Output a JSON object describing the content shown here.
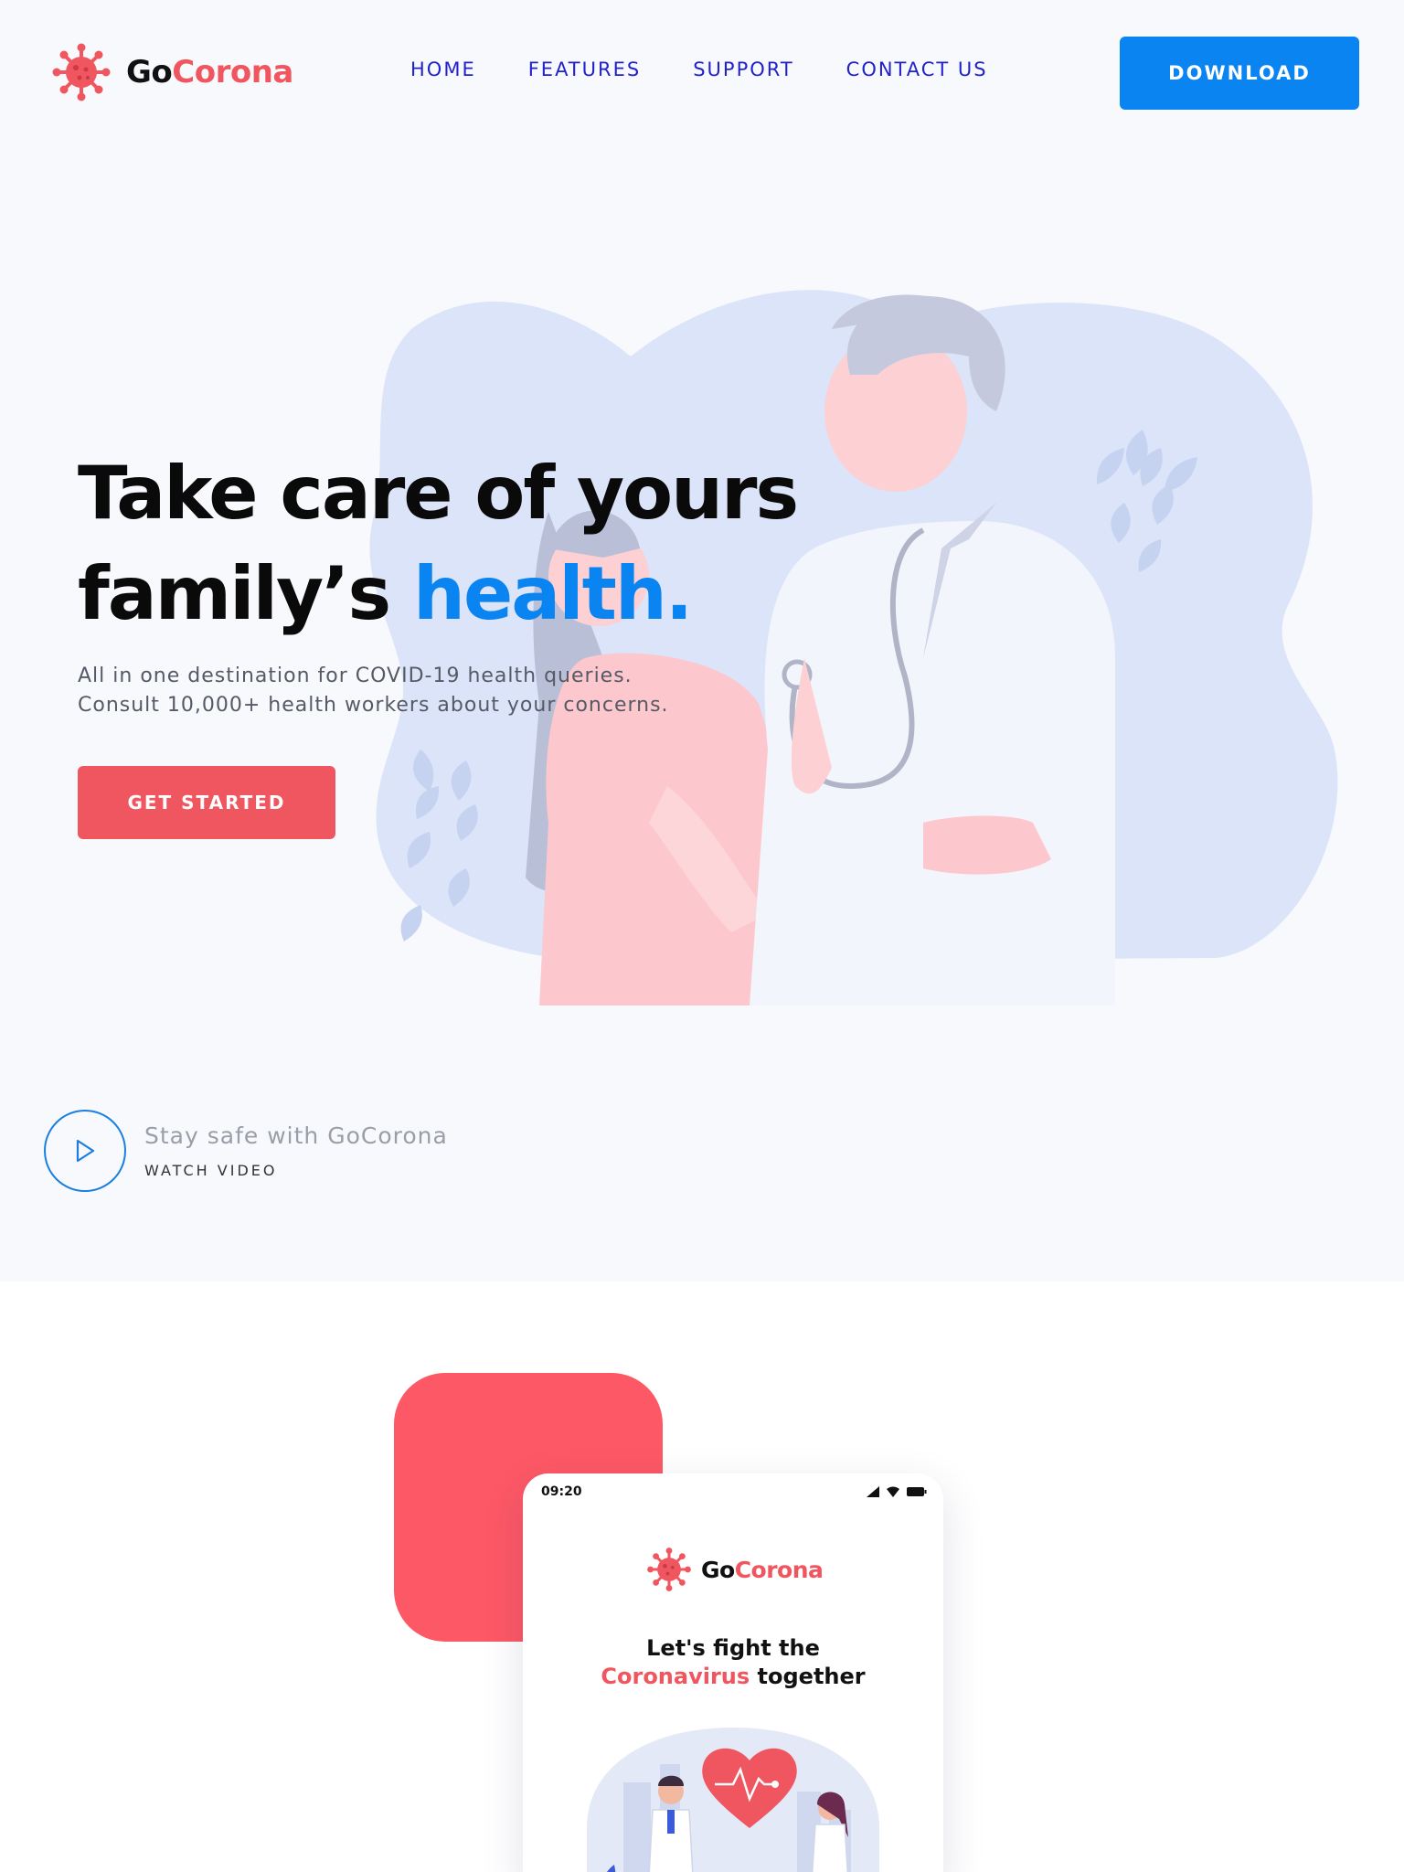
{
  "brand": {
    "name_part1": "Go",
    "name_part2": "Corona",
    "accent_color": "#f0565f",
    "primary_color": "#0a84f0"
  },
  "nav": {
    "items": [
      {
        "label": "HOME"
      },
      {
        "label": "FEATURES"
      },
      {
        "label": "SUPPORT"
      },
      {
        "label": "CONTACT US"
      }
    ],
    "download_label": "DOWNLOAD"
  },
  "hero": {
    "headline_line1": "Take care of yours",
    "headline_line2_plain": "family’s ",
    "headline_line2_accent": "health.",
    "subtext_line1": "All in one destination for COVID-19 health queries.",
    "subtext_line2": "Consult 10,000+ health workers about your concerns.",
    "cta_label": "GET STARTED",
    "video_title": "Stay safe with GoCorona",
    "video_label": "WATCH VIDEO",
    "illustration": "doctor-examining-patient-illustration"
  },
  "app_preview": {
    "status_time": "09:20",
    "status_icons": [
      "signal-icon",
      "wifi-icon",
      "battery-icon"
    ],
    "headline_line1": "Let's fight the",
    "headline_line2_accent": "Coronavirus",
    "headline_line2_plain": " together",
    "illustration": "doctors-heart-illustration"
  }
}
